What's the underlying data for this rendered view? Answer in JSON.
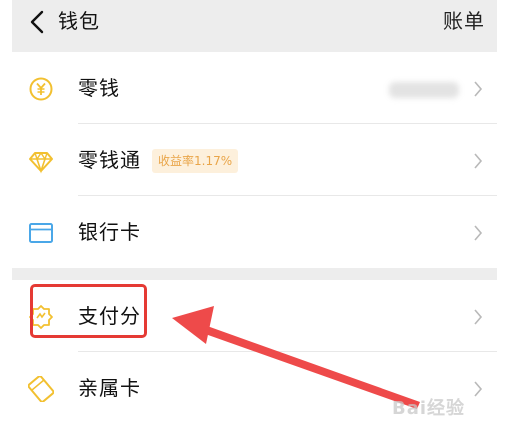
{
  "header": {
    "title": "钱包",
    "right_label": "账单"
  },
  "wallet_items": [
    {
      "label": "零钱",
      "icon": "yen-coin-icon"
    },
    {
      "label": "零钱通",
      "icon": "diamond-icon",
      "badge": "收益率1.17%"
    },
    {
      "label": "银行卡",
      "icon": "bank-card-icon"
    }
  ],
  "more_items": [
    {
      "label": "支付分",
      "icon": "payscore-icon"
    },
    {
      "label": "亲属卡",
      "icon": "family-card-icon"
    }
  ],
  "watermark": "Bai经验",
  "colors": {
    "nav_bg": "#ededed",
    "icon_yellow": "#f2c030",
    "icon_blue": "#4aa7e8",
    "badge_bg": "#fdf0dc",
    "badge_text": "#e9a549",
    "annotation_red": "#e53a34"
  }
}
